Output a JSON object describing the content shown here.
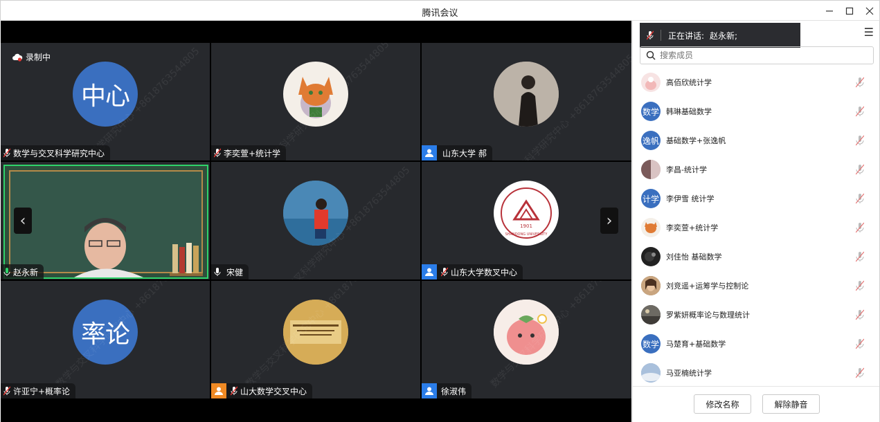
{
  "window": {
    "title": "腾讯会议",
    "min_icon": "minimize-icon",
    "max_icon": "maximize-icon",
    "close_icon": "close-icon"
  },
  "video": {
    "recording_label": "录制中",
    "tiles": [
      {
        "name": "数学与交叉科学研究中心",
        "avatar_text": "中心",
        "avatar_type": "text",
        "mic": "muted"
      },
      {
        "name": "李奕萱+统计学",
        "avatar_type": "image",
        "avatar_desc": "fox-cartoon",
        "mic": "muted"
      },
      {
        "name": "山东大学 郝",
        "avatar_type": "image",
        "avatar_desc": "person-photo",
        "badge": "user"
      },
      {
        "name": "赵永新",
        "avatar_type": "video",
        "mic": "active"
      },
      {
        "name": "宋健",
        "avatar_type": "image",
        "avatar_desc": "beach-photo",
        "mic": "on"
      },
      {
        "name": "山东大学数叉中心",
        "avatar_type": "image",
        "avatar_desc": "university-logo",
        "badge": "user",
        "mic": "muted"
      },
      {
        "name": "许亚宁+概率论",
        "avatar_text": "率论",
        "avatar_type": "text",
        "mic": "muted"
      },
      {
        "name": "山大数学交叉中心",
        "avatar_type": "image",
        "avatar_desc": "gold-plaque",
        "badge": "user-orange",
        "mic": "muted"
      },
      {
        "name": "徐淑伟",
        "avatar_type": "image",
        "avatar_desc": "strawberry-cartoon",
        "badge": "user"
      }
    ],
    "watermark": "数学与交叉科学研究中心 +8618763544805",
    "logo_text": "SHANDONG UNIVERSITY",
    "logo_year": "1901"
  },
  "panel": {
    "speaking_label": "正在讲话:",
    "speaking_name": "赵永新;",
    "search_placeholder": "搜索成员",
    "members": [
      {
        "name": "高佰欣统计学",
        "avatar_type": "image",
        "color": "#f2d6d6"
      },
      {
        "name": "韩琳基础数学",
        "avatar_text": "数学",
        "avatar_type": "text",
        "color": "#3a6fbf"
      },
      {
        "name": "基础数学+张逸帆",
        "avatar_text": "逸帆",
        "avatar_type": "text",
        "color": "#3a6fbf"
      },
      {
        "name": "李昌-统计学",
        "avatar_type": "image",
        "color": "#a08080"
      },
      {
        "name": "李伊雪 统计学",
        "avatar_text": "计学",
        "avatar_type": "text",
        "color": "#3a6fbf"
      },
      {
        "name": "李奕萱+统计学",
        "avatar_type": "image",
        "color": "#d9823b"
      },
      {
        "name": "刘佳怡 基础数学",
        "avatar_type": "image",
        "color": "#222222"
      },
      {
        "name": "刘竞遥+运筹学与控制论",
        "avatar_type": "image",
        "color": "#7a5a3a"
      },
      {
        "name": "罗紫妍概率论与数理统计",
        "avatar_type": "image",
        "color": "#555555"
      },
      {
        "name": "马楚育+基础数学",
        "avatar_text": "数学",
        "avatar_type": "text",
        "color": "#3a6fbf"
      },
      {
        "name": "马亚楠统计学",
        "avatar_type": "image",
        "color": "#8fa8c8"
      }
    ],
    "rename_label": "修改名称",
    "unmute_label": "解除静音"
  }
}
